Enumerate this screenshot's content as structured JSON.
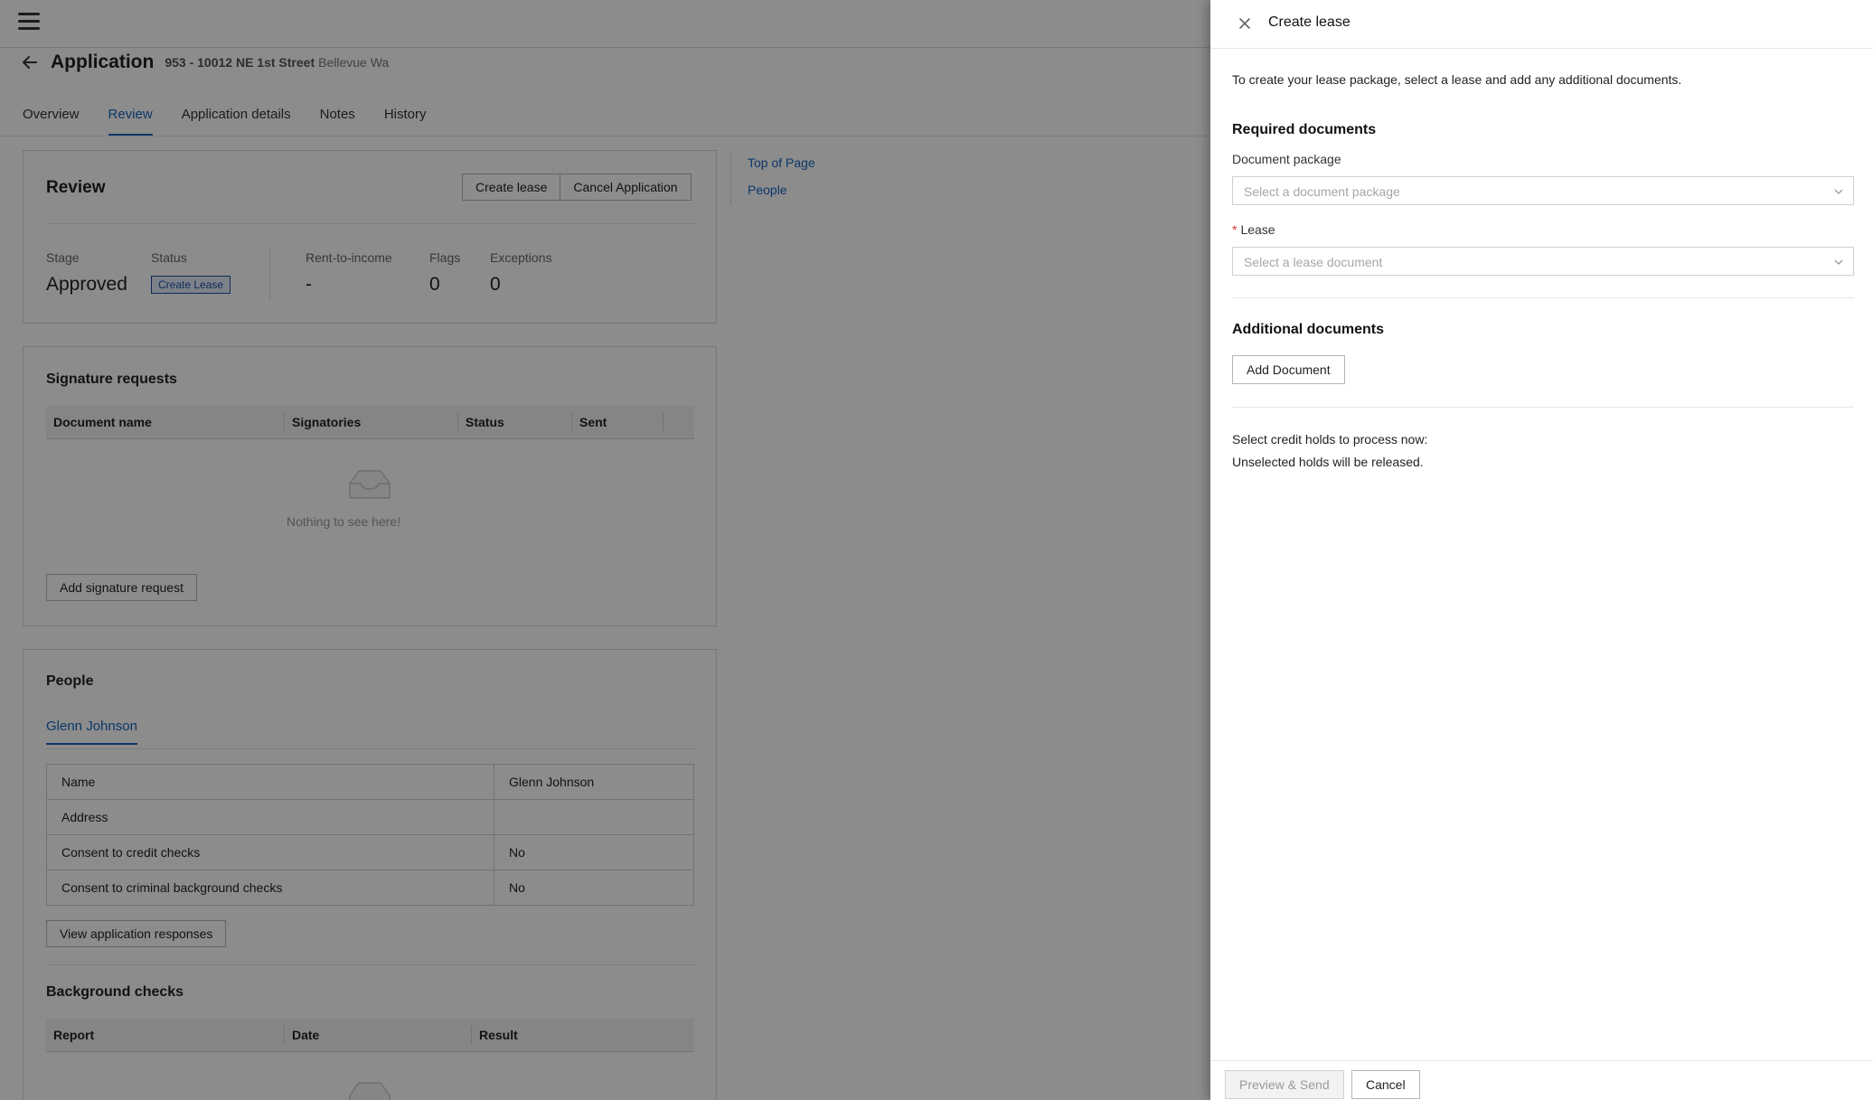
{
  "app": {
    "title": "Application",
    "address_number": "953 - 10012 NE 1st Street",
    "address_city": "Bellevue Wa"
  },
  "tabs": [
    {
      "label": "Overview"
    },
    {
      "label": "Review",
      "active": true
    },
    {
      "label": "Application details"
    },
    {
      "label": "Notes"
    },
    {
      "label": "History"
    }
  ],
  "review": {
    "title": "Review",
    "create_lease_label": "Create lease",
    "cancel_application_label": "Cancel Application",
    "stage_label": "Stage",
    "stage_value": "Approved",
    "status_label": "Status",
    "status_badge": "Create Lease",
    "rti_label": "Rent-to-income",
    "rti_value": "-",
    "flags_label": "Flags",
    "flags_value": "0",
    "exceptions_label": "Exceptions",
    "exceptions_value": "0"
  },
  "signature_requests": {
    "title": "Signature requests",
    "columns": [
      "Document name",
      "Signatories",
      "Status",
      "Sent"
    ],
    "empty_text": "Nothing to see here!",
    "add_label": "Add signature request"
  },
  "people": {
    "title": "People",
    "person_tab": "Glenn Johnson",
    "rows": [
      {
        "key": "Name",
        "value": "Glenn Johnson"
      },
      {
        "key": "Address",
        "value": ""
      },
      {
        "key": "Consent to credit checks",
        "value": "No"
      },
      {
        "key": "Consent to criminal background checks",
        "value": "No"
      }
    ],
    "view_responses_label": "View application responses",
    "background_checks_title": "Background checks",
    "bg_columns": [
      "Report",
      "Date",
      "Result"
    ]
  },
  "toc": {
    "top_of_page": "Top of Page",
    "people": "People"
  },
  "drawer": {
    "title": "Create lease",
    "intro": "To create your lease package, select a lease and add any additional documents.",
    "required_title": "Required documents",
    "package_label": "Document package",
    "package_placeholder": "Select a document package",
    "lease_star": "*",
    "lease_label": "Lease",
    "lease_placeholder": "Select a lease document",
    "additional_title": "Additional documents",
    "add_document_label": "Add Document",
    "credit_line1": "Select credit holds to process now:",
    "credit_line2": "Unselected holds will be released.",
    "preview_send_label": "Preview & Send",
    "cancel_label": "Cancel"
  },
  "colors": {
    "accent": "#1565c0",
    "required": "#d32f2f",
    "badge_bg": "#e4ecfb"
  }
}
